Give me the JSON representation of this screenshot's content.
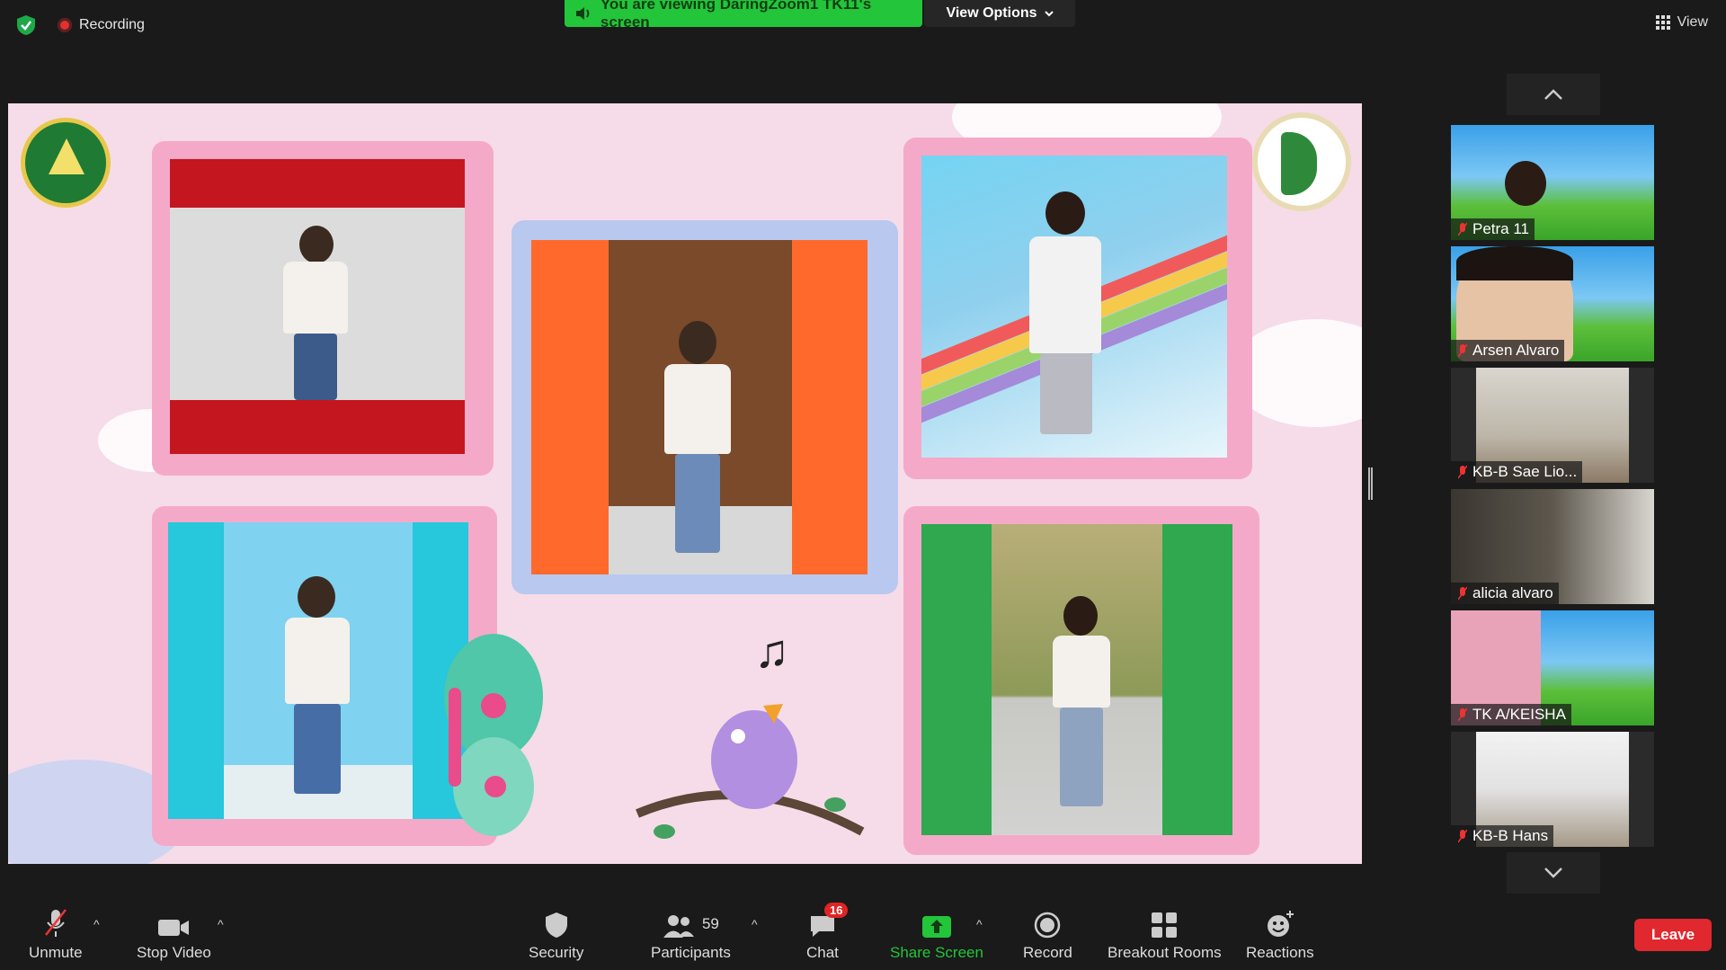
{
  "topbar": {
    "recording_label": "Recording",
    "viewing_banner": "You are viewing DaringZoom1 TK11's screen",
    "view_options_label": "View Options",
    "view_label": "View"
  },
  "gallery": {
    "participants": [
      {
        "name": "Petra 11"
      },
      {
        "name": "Arsen Alvaro"
      },
      {
        "name": "KB-B Sae Lio..."
      },
      {
        "name": "alicia alvaro"
      },
      {
        "name": "TK A/KEISHA"
      },
      {
        "name": "KB-B Hans"
      }
    ]
  },
  "toolbar": {
    "unmute": "Unmute",
    "stop_video": "Stop Video",
    "security": "Security",
    "participants": "Participants",
    "participants_count": "59",
    "chat": "Chat",
    "chat_badge": "16",
    "share_screen": "Share Screen",
    "record": "Record",
    "breakout_rooms": "Breakout Rooms",
    "reactions": "Reactions",
    "leave": "Leave"
  },
  "colors": {
    "accent_green": "#23c53a",
    "leave_red": "#e0282e",
    "background": "#1a1a1a",
    "slide_pink": "#f6dce8"
  },
  "icons": [
    "shield-icon",
    "record-icon",
    "speaker-icon",
    "chevron-down-icon",
    "grid-view-icon",
    "muted-mic-icon",
    "video-camera-icon",
    "participants-icon",
    "chat-icon",
    "share-screen-icon",
    "record-button-icon",
    "breakout-rooms-icon",
    "reactions-icon"
  ]
}
